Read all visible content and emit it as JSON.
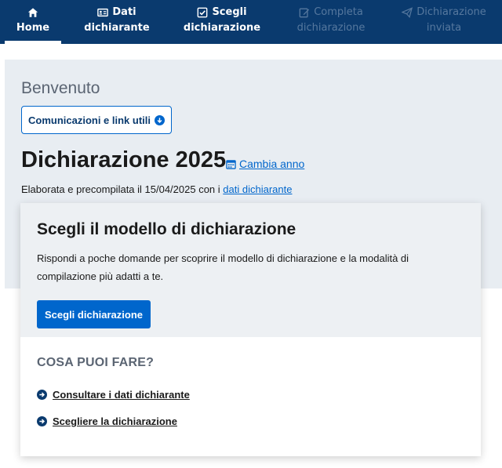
{
  "nav": {
    "home": {
      "label": "Home"
    },
    "dati": {
      "line1": "Dati",
      "line2": "dichiarante"
    },
    "scegli": {
      "line1": "Scegli",
      "line2": "dichiarazione"
    },
    "completa": {
      "line1": "Completa",
      "line2": "dichiarazione"
    },
    "inviata": {
      "line1": "Dichiarazione",
      "line2": "inviata"
    }
  },
  "header": {
    "welcome": "Benvenuto",
    "comm_button": "Comunicazioni e link utili",
    "title": "Dichiarazione 2025",
    "cambia_anno": "Cambia anno",
    "elab_text": "Elaborata e precompilata il 15/04/2025 con i",
    "elab_link": "dati dichiarante"
  },
  "card": {
    "title": "Scegli il modello di dichiarazione",
    "description": "Rispondi a poche domande per scoprire il modello di dichiarazione e la modalità di compilazione più adatti a te.",
    "button": "Scegli dichiarazione",
    "section_title": "COSA PUOI FARE?",
    "actions": [
      {
        "label": "Consultare i dati dichiarante"
      },
      {
        "label": "Scegliere la dichiarazione"
      }
    ]
  },
  "colors": {
    "nav_bg": "#0a3a6e",
    "accent": "#0066cc",
    "grey_bg": "#e8edf2",
    "card_top_bg": "#edf0f3"
  },
  "icons": {
    "home": "home-icon",
    "dati": "id-card-icon",
    "scegli": "checkbox-icon",
    "completa": "edit-icon",
    "inviata": "paper-plane-icon",
    "comm": "arrow-down-circle-icon",
    "calendar": "calendar-icon",
    "action": "arrow-right-circle-icon"
  }
}
